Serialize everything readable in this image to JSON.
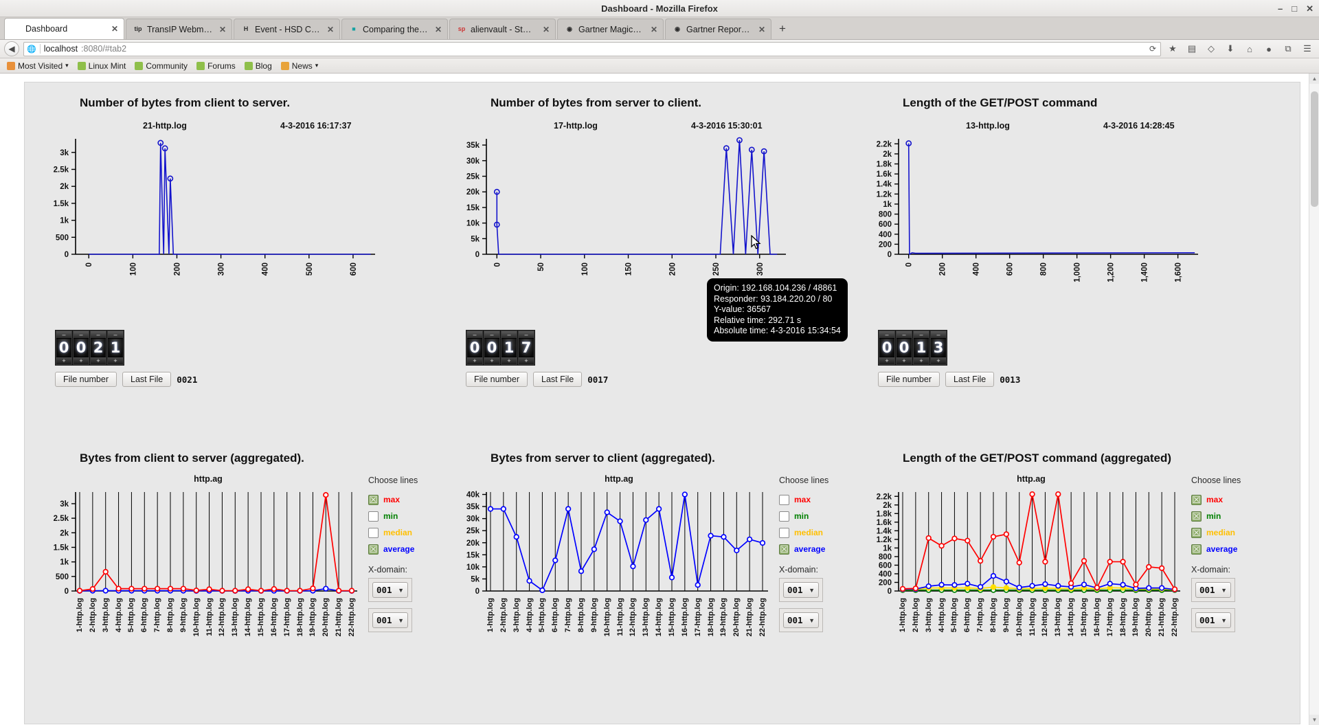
{
  "window": {
    "title": "Dashboard - Mozilla Firefox",
    "controls": [
      "–",
      "□",
      "✕"
    ]
  },
  "tabs": [
    {
      "label": "Dashboard",
      "icon": "",
      "active": true,
      "close": "✕"
    },
    {
      "label": "TransIP Webmail :: Net...",
      "icon": "tip",
      "active": false,
      "close": "✕"
    },
    {
      "label": "Event - HSD Café: Inti...",
      "icon": "H",
      "active": false,
      "close": "✕"
    },
    {
      "label": "Comparing the best SI...",
      "icon": "■",
      "active": false,
      "close": "✕"
    },
    {
      "label": "alienvault - Startpage ...",
      "icon": "sp",
      "active": false,
      "close": "✕"
    },
    {
      "label": "Gartner Magic Quadra...",
      "icon": "◉",
      "active": false,
      "close": "✕"
    },
    {
      "label": "Gartner Report: Magic ...",
      "icon": "◉",
      "active": false,
      "close": "✕"
    }
  ],
  "newtab_label": "+",
  "navbar": {
    "back": "◀",
    "url_host": "localhost",
    "url_path": ":8080/#tab2",
    "reload": "⟳",
    "icons": [
      "★",
      "▤",
      "◇",
      "⬇",
      "⌂",
      "●",
      "⧉",
      "☰"
    ]
  },
  "bookmarks": [
    {
      "label": "Most Visited",
      "caret": "▾",
      "color": "#e8903a"
    },
    {
      "label": "Linux Mint",
      "caret": "",
      "color": "#8fbf4a"
    },
    {
      "label": "Community",
      "caret": "",
      "color": "#8fbf4a"
    },
    {
      "label": "Forums",
      "caret": "",
      "color": "#8fbf4a"
    },
    {
      "label": "Blog",
      "caret": "",
      "color": "#8fbf4a"
    },
    {
      "label": "News",
      "caret": "▾",
      "color": "#e8a33a"
    }
  ],
  "tooltip": {
    "lines": [
      "Origin: 192.168.104.236 / 48861",
      "Responder: 93.184.220.20 / 80",
      "Y-value: 36567",
      "Relative time: 292.71 s",
      "Absolute time: 4-3-2016 15:34:54"
    ]
  },
  "controls": {
    "file_number_label": "File number",
    "last_file_label": "Last File",
    "choose_lines_label": "Choose lines",
    "xdomain_label": "X-domain:",
    "select_value": "001",
    "caret": "▼"
  },
  "top_charts": [
    {
      "title": "Number of bytes from client to server.",
      "file": "21-http.log",
      "timestamp": "4-3-2016 16:17:37",
      "digits": [
        "0",
        "0",
        "2",
        "1"
      ],
      "last_file": "0021"
    },
    {
      "title": "Number of bytes from server to client.",
      "file": "17-http.log",
      "timestamp": "4-3-2016 15:30:01",
      "digits": [
        "0",
        "0",
        "1",
        "7"
      ],
      "last_file": "0017"
    },
    {
      "title": "Length of the GET/POST command",
      "file": "13-http.log",
      "timestamp": "4-3-2016 14:28:45",
      "digits": [
        "0",
        "0",
        "1",
        "3"
      ],
      "last_file": "0013"
    }
  ],
  "bottom_charts": [
    {
      "title": "Bytes from client to server (aggregated)."
    },
    {
      "title": "Bytes from server to client (aggregated)."
    },
    {
      "title": "Length of the GET/POST command (aggregated)"
    }
  ],
  "series_colors": {
    "max": "#ff0000",
    "min": "#008000",
    "median": "#ffbf00",
    "average": "#0000ff",
    "line": "#1414cc"
  },
  "chart_data": [
    {
      "id": "top-left",
      "type": "line",
      "title": "Number of bytes from client to server.",
      "subtitle": "21-http.log",
      "annotation": "4-3-2016 16:17:37",
      "xlabel": "",
      "ylabel": "",
      "xlim": [
        -30,
        650
      ],
      "ylim": [
        0,
        3400
      ],
      "yticks": [
        0,
        500,
        1000,
        1500,
        2000,
        2500,
        3000
      ],
      "ytick_labels": [
        "0",
        "500",
        "1k",
        "1.5k",
        "2k",
        "2.5k",
        "3k"
      ],
      "xticks": [
        0,
        100,
        200,
        300,
        400,
        500,
        600
      ],
      "xtick_labels": [
        "0",
        "100",
        "200",
        "300",
        "400",
        "500",
        "600"
      ],
      "grid": false,
      "series": [
        {
          "name": "value",
          "color": "#1414cc",
          "x": [
            0,
            160,
            163,
            170,
            173,
            182,
            185,
            192,
            640
          ],
          "y": [
            0,
            0,
            3280,
            0,
            3120,
            0,
            2230,
            0,
            0
          ]
        }
      ]
    },
    {
      "id": "top-middle",
      "type": "line",
      "title": "Number of bytes from server to client.",
      "subtitle": "17-http.log",
      "annotation": "4-3-2016 15:30:01",
      "xlabel": "",
      "ylabel": "",
      "xlim": [
        -12,
        330
      ],
      "ylim": [
        0,
        37000
      ],
      "yticks": [
        0,
        5000,
        10000,
        15000,
        20000,
        25000,
        30000,
        35000
      ],
      "ytick_labels": [
        "0",
        "5k",
        "10k",
        "15k",
        "20k",
        "25k",
        "30k",
        "35k"
      ],
      "xticks": [
        0,
        50,
        100,
        150,
        200,
        250,
        300
      ],
      "xtick_labels": [
        "0",
        "50",
        "100",
        "150",
        "200",
        "250",
        "300"
      ],
      "grid": false,
      "series": [
        {
          "name": "value",
          "color": "#1414cc",
          "x": [
            0,
            0,
            2,
            255,
            262,
            270,
            277,
            284,
            291,
            298,
            305,
            312,
            320
          ],
          "y": [
            20000,
            9500,
            0,
            0,
            34000,
            0,
            36567,
            0,
            33500,
            0,
            33000,
            0,
            0
          ]
        }
      ]
    },
    {
      "id": "top-right",
      "type": "line",
      "title": "Length of the GET/POST command",
      "subtitle": "13-http.log",
      "annotation": "4-3-2016 14:28:45",
      "xlabel": "",
      "ylabel": "",
      "xlim": [
        -60,
        1720
      ],
      "ylim": [
        0,
        2300
      ],
      "yticks": [
        0,
        200,
        400,
        600,
        800,
        1000,
        1200,
        1400,
        1600,
        1800,
        2000,
        2200
      ],
      "ytick_labels": [
        "0",
        "200",
        "400",
        "600",
        "800",
        "1k",
        "1.2k",
        "1.4k",
        "1.6k",
        "1.8k",
        "2k",
        "2.2k"
      ],
      "xticks": [
        0,
        200,
        400,
        600,
        800,
        1000,
        1200,
        1400,
        1600
      ],
      "xtick_labels": [
        "0",
        "200",
        "400",
        "600",
        "800",
        "1,000",
        "1,200",
        "1,400",
        "1,600"
      ],
      "grid": false,
      "series": [
        {
          "name": "value",
          "color": "#1414cc",
          "x": [
            0,
            5,
            20,
            40,
            1700
          ],
          "y": [
            2210,
            0,
            30,
            20,
            30
          ]
        }
      ]
    },
    {
      "id": "bottom-left",
      "type": "line",
      "title": "Bytes from client to server (aggregated).",
      "subtitle": "http.ag",
      "categories": [
        "1-http.log",
        "2-http.log",
        "3-http.log",
        "4-http.log",
        "5-http.log",
        "6-http.log",
        "7-http.log",
        "8-http.log",
        "9-http.log",
        "10-http.log",
        "11-http.log",
        "12-http.log",
        "13-http.log",
        "14-http.log",
        "15-http.log",
        "16-http.log",
        "17-http.log",
        "18-http.log",
        "19-http.log",
        "20-http.log",
        "21-http.log",
        "22-http.log"
      ],
      "ylim": [
        0,
        3400
      ],
      "yticks": [
        0,
        500,
        1000,
        1500,
        2000,
        2500,
        3000
      ],
      "ytick_labels": [
        "0",
        "500",
        "1k",
        "1.5k",
        "2k",
        "2.5k",
        "3k"
      ],
      "grid": true,
      "grid_axis": "x",
      "legend_position": "right",
      "legend": [
        "max",
        "min",
        "median",
        "average"
      ],
      "legend_checked": [
        true,
        false,
        false,
        true
      ],
      "series": [
        {
          "name": "max",
          "color": "#ff0000",
          "values": [
            10,
            70,
            660,
            80,
            80,
            80,
            80,
            80,
            80,
            20,
            60,
            10,
            10,
            60,
            10,
            70,
            10,
            10,
            90,
            3300,
            10,
            10
          ]
        },
        {
          "name": "average",
          "color": "#0000ff",
          "values": [
            5,
            10,
            10,
            10,
            10,
            10,
            10,
            10,
            10,
            5,
            8,
            5,
            5,
            8,
            5,
            8,
            5,
            5,
            10,
            80,
            5,
            5
          ]
        }
      ]
    },
    {
      "id": "bottom-middle",
      "type": "line",
      "title": "Bytes from server to client (aggregated).",
      "subtitle": "http.ag",
      "categories": [
        "1-http.log",
        "2-http.log",
        "3-http.log",
        "4-http.log",
        "5-http.log",
        "6-http.log",
        "7-http.log",
        "8-http.log",
        "9-http.log",
        "10-http.log",
        "11-http.log",
        "12-http.log",
        "13-http.log",
        "14-http.log",
        "15-http.log",
        "16-http.log",
        "17-http.log",
        "18-http.log",
        "19-http.log",
        "20-http.log",
        "21-http.log",
        "22-http.log"
      ],
      "ylim": [
        0,
        41000
      ],
      "yticks": [
        0,
        5000,
        10000,
        15000,
        20000,
        25000,
        30000,
        35000,
        40000
      ],
      "ytick_labels": [
        "0",
        "5k",
        "10k",
        "15k",
        "20k",
        "25k",
        "30k",
        "35k",
        "40k"
      ],
      "grid": true,
      "grid_axis": "x",
      "legend_position": "right",
      "legend": [
        "max",
        "min",
        "median",
        "average"
      ],
      "legend_checked": [
        false,
        false,
        false,
        true
      ],
      "series": [
        {
          "name": "average",
          "color": "#0000ff",
          "values": [
            34000,
            34000,
            22400,
            4200,
            300,
            12700,
            34000,
            8200,
            17300,
            32600,
            28900,
            10200,
            29400,
            34000,
            5600,
            40000,
            2500,
            22900,
            22400,
            16800,
            21400,
            19900
          ]
        }
      ]
    },
    {
      "id": "bottom-right",
      "type": "line",
      "title": "Length of the GET/POST command (aggregated)",
      "subtitle": "http.ag",
      "categories": [
        "1-http.log",
        "2-http.log",
        "3-http.log",
        "4-http.log",
        "5-http.log",
        "6-http.log",
        "7-http.log",
        "8-http.log",
        "9-http.log",
        "10-http.log",
        "11-http.log",
        "12-http.log",
        "13-http.log",
        "14-http.log",
        "15-http.log",
        "16-http.log",
        "17-http.log",
        "18-http.log",
        "19-http.log",
        "20-http.log",
        "21-http.log",
        "22-http.log"
      ],
      "ylim": [
        0,
        2300
      ],
      "yticks": [
        0,
        200,
        400,
        600,
        800,
        1000,
        1200,
        1400,
        1600,
        1800,
        2000,
        2200
      ],
      "ytick_labels": [
        "0",
        "200",
        "400",
        "600",
        "800",
        "1k",
        "1.2k",
        "1.4k",
        "1.6k",
        "1.8k",
        "2k",
        "2.2k"
      ],
      "grid": true,
      "grid_axis": "x",
      "legend_position": "right",
      "legend": [
        "max",
        "min",
        "median",
        "average"
      ],
      "legend_checked": [
        true,
        true,
        true,
        true
      ],
      "series": [
        {
          "name": "max",
          "color": "#ff0000",
          "values": [
            50,
            60,
            1230,
            1050,
            1220,
            1170,
            700,
            1260,
            1320,
            660,
            2250,
            680,
            2250,
            180,
            700,
            80,
            680,
            680,
            150,
            560,
            530,
            40
          ]
        },
        {
          "name": "average",
          "color": "#0000ff",
          "values": [
            40,
            45,
            110,
            145,
            140,
            170,
            95,
            350,
            220,
            80,
            120,
            160,
            120,
            95,
            150,
            70,
            170,
            145,
            60,
            70,
            70,
            35
          ]
        },
        {
          "name": "median",
          "color": "#ffe000",
          "values": [
            35,
            40,
            70,
            70,
            70,
            70,
            60,
            90,
            70,
            55,
            60,
            65,
            60,
            55,
            70,
            50,
            75,
            70,
            45,
            50,
            50,
            30
          ]
        },
        {
          "name": "min",
          "color": "#008000",
          "values": [
            20,
            20,
            20,
            20,
            20,
            20,
            20,
            20,
            20,
            20,
            20,
            20,
            20,
            20,
            20,
            20,
            20,
            20,
            20,
            20,
            20,
            20
          ]
        }
      ]
    }
  ]
}
